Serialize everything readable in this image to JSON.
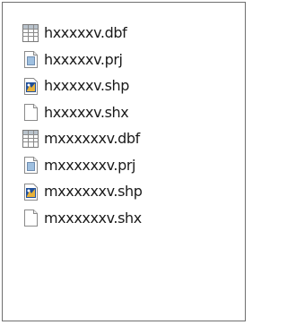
{
  "files": [
    {
      "name": "hxxxxxv.dbf",
      "icon": "table-file-icon"
    },
    {
      "name": "hxxxxxv.prj",
      "icon": "text-file-icon"
    },
    {
      "name": "hxxxxxv.shp",
      "icon": "shape-file-icon"
    },
    {
      "name": "hxxxxxv.shx",
      "icon": "blank-file-icon"
    },
    {
      "name": "mxxxxxxv.dbf",
      "icon": "table-file-icon"
    },
    {
      "name": "mxxxxxxv.prj",
      "icon": "text-file-icon"
    },
    {
      "name": "mxxxxxxv.shp",
      "icon": "shape-file-icon"
    },
    {
      "name": "mxxxxxxv.shx",
      "icon": "blank-file-icon"
    }
  ]
}
